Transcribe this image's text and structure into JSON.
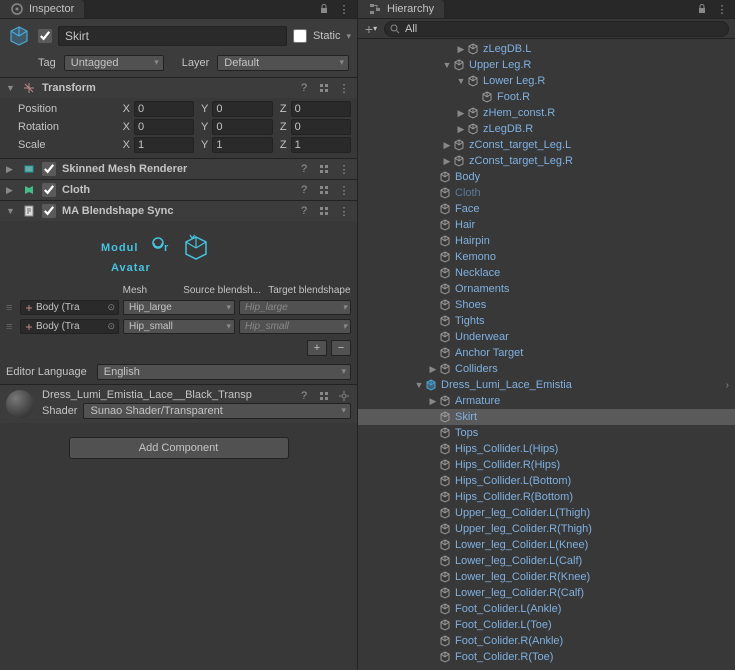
{
  "inspector": {
    "tab_title": "Inspector",
    "go": {
      "active": true,
      "name": "Skirt",
      "static": false,
      "static_label": "Static",
      "tag_label": "Tag",
      "tag": "Untagged",
      "layer_label": "Layer",
      "layer": "Default"
    },
    "transform": {
      "title": "Transform",
      "position": {
        "label": "Position",
        "x": "0",
        "y": "0",
        "z": "0"
      },
      "rotation": {
        "label": "Rotation",
        "x": "0",
        "y": "0",
        "z": "0"
      },
      "scale": {
        "label": "Scale",
        "x": "1",
        "y": "1",
        "z": "1"
      }
    },
    "smr": {
      "title": "Skinned Mesh Renderer"
    },
    "cloth": {
      "title": "Cloth"
    },
    "blendshape": {
      "title": "MA Blendshape Sync",
      "cols": {
        "mesh": "Mesh",
        "src": "Source blendsh...",
        "tgt": "Target blendshape"
      },
      "rows": [
        {
          "mesh": "Body (Tra",
          "src": "Hip_large",
          "tgt": "Hip_large"
        },
        {
          "mesh": "Body (Tra",
          "src": "Hip_small",
          "tgt": "Hip_small"
        }
      ]
    },
    "lang_label": "Editor Language",
    "lang": "English",
    "material": {
      "name": "Dress_Lumi_Emistia_Lace__Black_Transp",
      "shader_label": "Shader",
      "shader": "Sunao Shader/Transparent"
    },
    "add_component": "Add Component"
  },
  "hierarchy": {
    "tab_title": "Hierarchy",
    "search_placeholder": "All",
    "tree": [
      {
        "d": 7,
        "f": "▶",
        "label": "zLegDB.L",
        "cls": "prefab"
      },
      {
        "d": 6,
        "f": "▼",
        "label": "Upper Leg.R",
        "cls": "prefab"
      },
      {
        "d": 7,
        "f": "▼",
        "label": "Lower Leg.R",
        "cls": "prefab"
      },
      {
        "d": 8,
        "f": "",
        "label": "Foot.R",
        "cls": "prefab"
      },
      {
        "d": 7,
        "f": "▶",
        "label": "zHem_const.R",
        "cls": "prefab"
      },
      {
        "d": 7,
        "f": "▶",
        "label": "zLegDB.R",
        "cls": "prefab"
      },
      {
        "d": 6,
        "f": "▶",
        "label": "zConst_target_Leg.L",
        "cls": "prefab"
      },
      {
        "d": 6,
        "f": "▶",
        "label": "zConst_target_Leg.R",
        "cls": "prefab"
      },
      {
        "d": 5,
        "f": "",
        "label": "Body",
        "cls": "prefab"
      },
      {
        "d": 5,
        "f": "",
        "label": "Cloth",
        "cls": "dim"
      },
      {
        "d": 5,
        "f": "",
        "label": "Face",
        "cls": "prefab"
      },
      {
        "d": 5,
        "f": "",
        "label": "Hair",
        "cls": "prefab"
      },
      {
        "d": 5,
        "f": "",
        "label": "Hairpin",
        "cls": "prefab"
      },
      {
        "d": 5,
        "f": "",
        "label": "Kemono",
        "cls": "prefab"
      },
      {
        "d": 5,
        "f": "",
        "label": "Necklace",
        "cls": "prefab"
      },
      {
        "d": 5,
        "f": "",
        "label": "Ornaments",
        "cls": "prefab"
      },
      {
        "d": 5,
        "f": "",
        "label": "Shoes",
        "cls": "prefab"
      },
      {
        "d": 5,
        "f": "",
        "label": "Tights",
        "cls": "prefab"
      },
      {
        "d": 5,
        "f": "",
        "label": "Underwear",
        "cls": "prefab"
      },
      {
        "d": 5,
        "f": "",
        "label": "Anchor Target",
        "cls": "prefab"
      },
      {
        "d": 5,
        "f": "▶",
        "label": "Colliders",
        "cls": "prefab"
      },
      {
        "d": 4,
        "f": "▼",
        "label": "Dress_Lumi_Lace_Emistia",
        "cls": "prefab",
        "arrow": true,
        "pfroot": true
      },
      {
        "d": 5,
        "f": "▶",
        "label": "Armature",
        "cls": "prefab"
      },
      {
        "d": 5,
        "f": "",
        "label": "Skirt",
        "cls": "prefab",
        "sel": true
      },
      {
        "d": 5,
        "f": "",
        "label": "Tops",
        "cls": "prefab"
      },
      {
        "d": 5,
        "f": "",
        "label": "Hips_Collider.L(Hips)",
        "cls": "prefab"
      },
      {
        "d": 5,
        "f": "",
        "label": "Hips_Collider.R(Hips)",
        "cls": "prefab"
      },
      {
        "d": 5,
        "f": "",
        "label": "Hips_Collider.L(Bottom)",
        "cls": "prefab"
      },
      {
        "d": 5,
        "f": "",
        "label": "Hips_Collider.R(Bottom)",
        "cls": "prefab"
      },
      {
        "d": 5,
        "f": "",
        "label": "Upper_leg_Colider.L(Thigh)",
        "cls": "prefab"
      },
      {
        "d": 5,
        "f": "",
        "label": "Upper_leg_Colider.R(Thigh)",
        "cls": "prefab"
      },
      {
        "d": 5,
        "f": "",
        "label": "Lower_leg_Colider.L(Knee)",
        "cls": "prefab"
      },
      {
        "d": 5,
        "f": "",
        "label": "Lower_leg_Colider.L(Calf)",
        "cls": "prefab"
      },
      {
        "d": 5,
        "f": "",
        "label": "Lower_leg_Colider.R(Knee)",
        "cls": "prefab"
      },
      {
        "d": 5,
        "f": "",
        "label": "Lower_leg_Colider.R(Calf)",
        "cls": "prefab"
      },
      {
        "d": 5,
        "f": "",
        "label": "Foot_Colider.L(Ankle)",
        "cls": "prefab"
      },
      {
        "d": 5,
        "f": "",
        "label": "Foot_Colider.L(Toe)",
        "cls": "prefab"
      },
      {
        "d": 5,
        "f": "",
        "label": "Foot_Colider.R(Ankle)",
        "cls": "prefab"
      },
      {
        "d": 5,
        "f": "",
        "label": "Foot_Colider.R(Toe)",
        "cls": "prefab"
      }
    ]
  }
}
